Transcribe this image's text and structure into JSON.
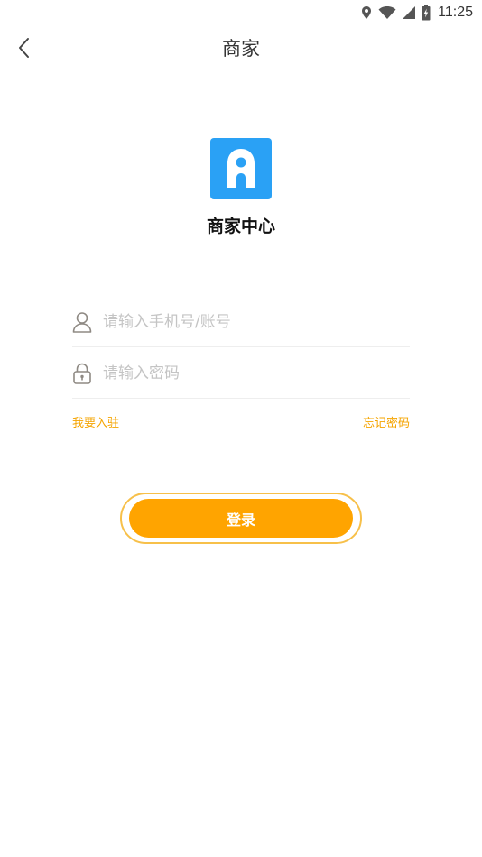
{
  "status_bar": {
    "time": "11:25",
    "icons": [
      "location-icon",
      "wifi-icon",
      "signal-icon",
      "battery-charging-icon"
    ]
  },
  "header": {
    "back_icon": "chevron-left-icon",
    "title": "商家"
  },
  "brand": {
    "logo_icon": "app-logo-icon",
    "logo_color": "#2AA1F5",
    "name": "商家中心"
  },
  "form": {
    "account": {
      "icon": "user-icon",
      "value": "",
      "placeholder": "请输入手机号/账号"
    },
    "password": {
      "icon": "lock-icon",
      "value": "",
      "placeholder": "请输入密码"
    }
  },
  "links": {
    "join": "我要入驻",
    "forgot": "忘记密码",
    "color": "#F5A400"
  },
  "login": {
    "label": "登录",
    "color": "#FFA400"
  }
}
